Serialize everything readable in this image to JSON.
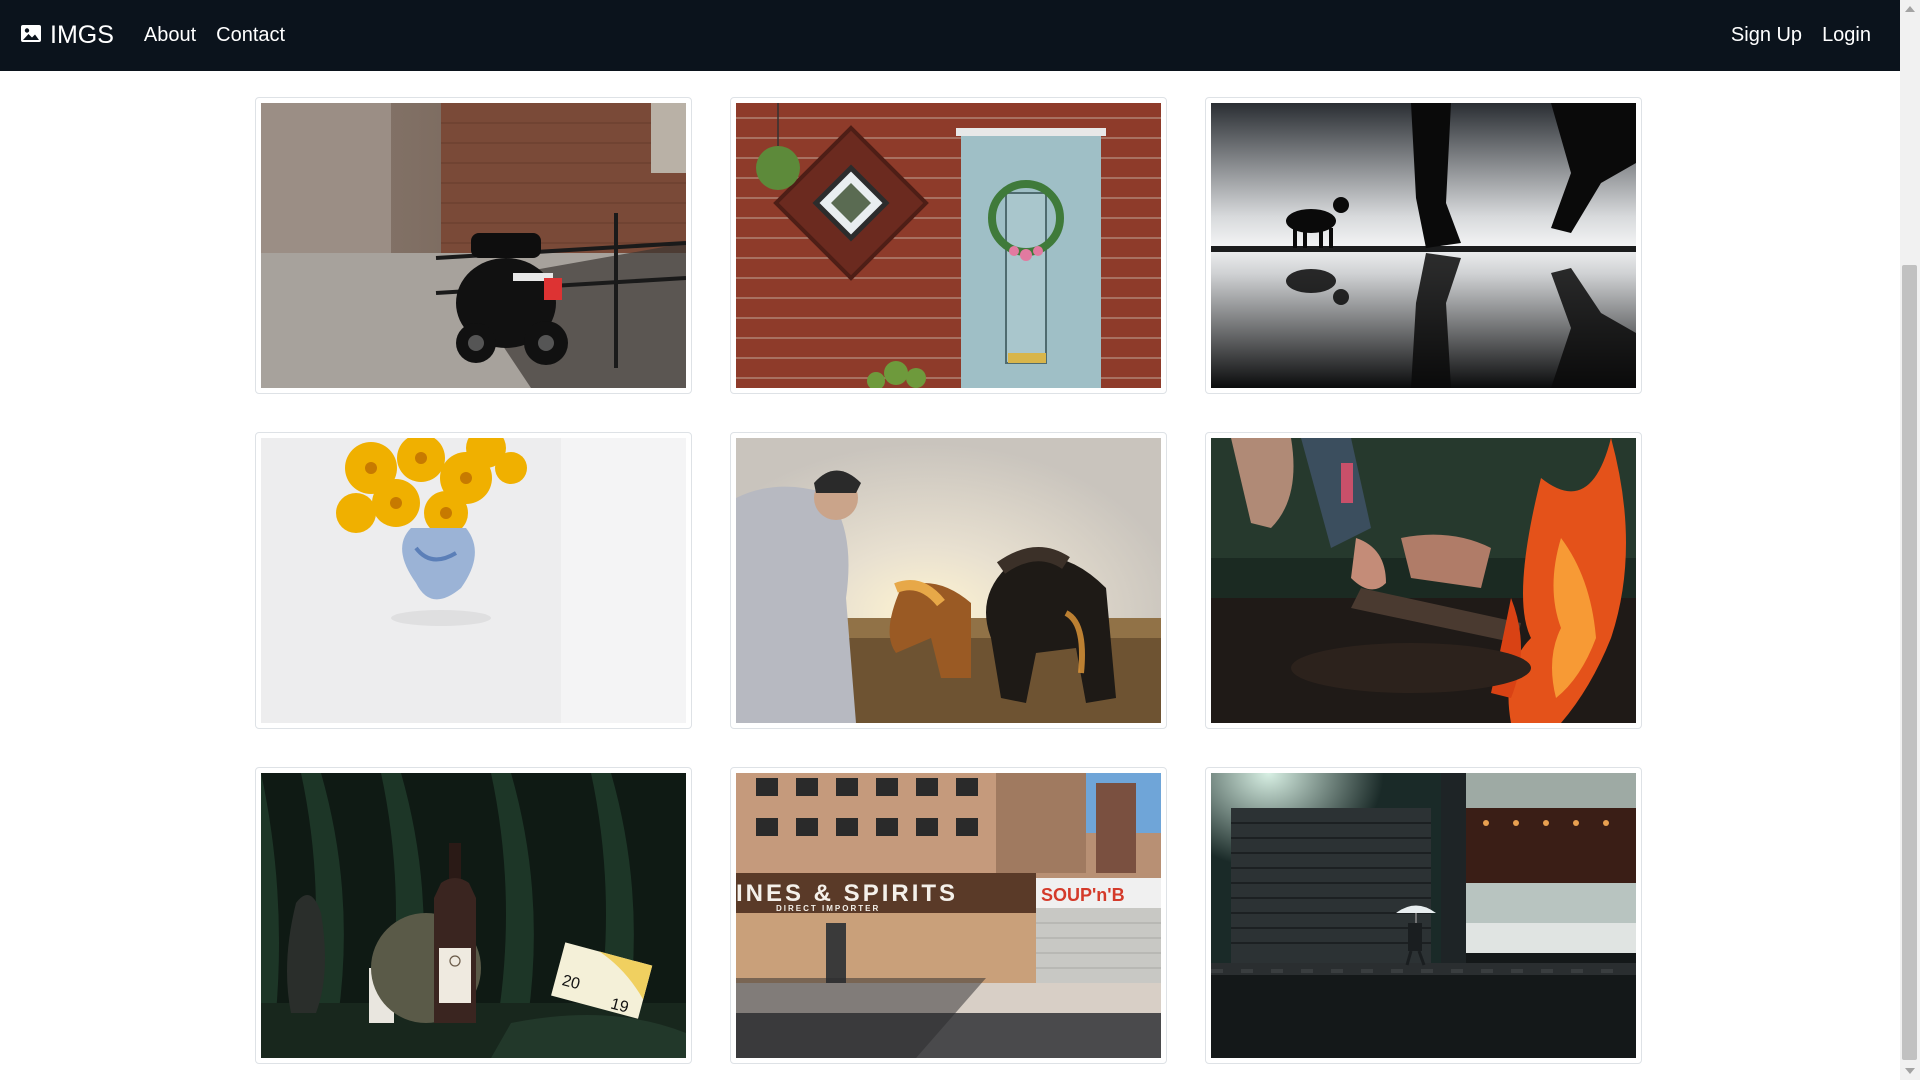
{
  "navbar": {
    "brand": {
      "icon": "image-icon",
      "label": "IMGS"
    },
    "left_links": [
      {
        "label": "About"
      },
      {
        "label": "Contact"
      }
    ],
    "right_links": [
      {
        "label": "Sign Up"
      },
      {
        "label": "Login"
      }
    ],
    "background": "#0b131c"
  },
  "gallery": {
    "photos": [
      {
        "subject": "scooter parked in alley"
      },
      {
        "subject": "brick wall with blue door"
      },
      {
        "subject": "dog silhouette with reflection"
      },
      {
        "subject": "yellow flowers in vase"
      },
      {
        "subject": "person feeding horses at sunset"
      },
      {
        "subject": "hand over campfire"
      },
      {
        "subject": "wine bottle still life"
      },
      {
        "subject": "wines and spirits storefront"
      },
      {
        "subject": "person with umbrella at night"
      }
    ]
  },
  "photo_text": {
    "storefront_sign": "INES & SPIRITS",
    "storefront_sub": "DIRECT IMPORTER",
    "storefront_soup": "SOUP'n'B",
    "wine_card_a": "20",
    "wine_card_b": "19"
  }
}
